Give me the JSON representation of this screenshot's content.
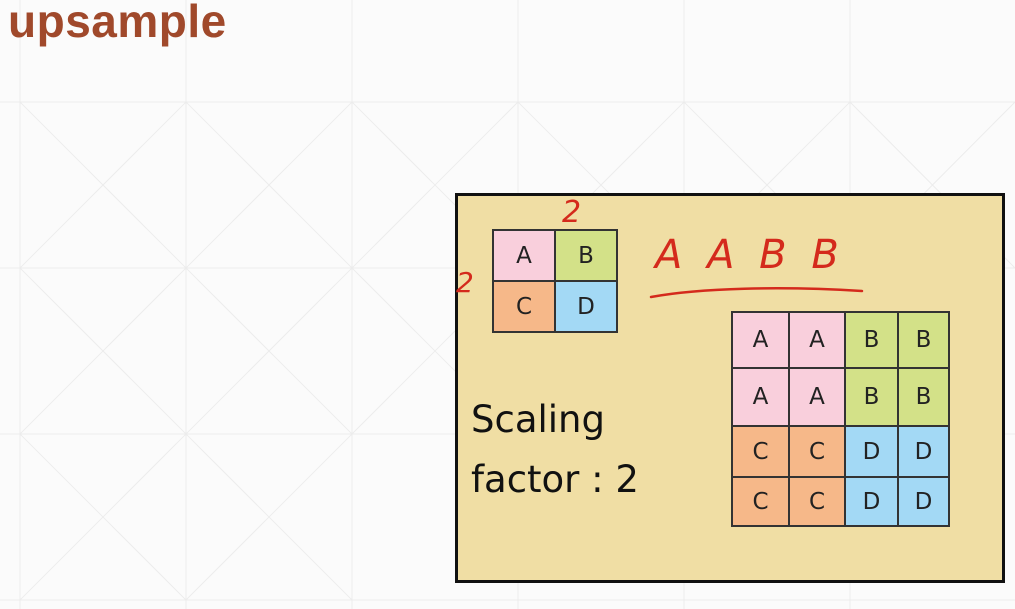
{
  "slide": {
    "title": "upsample"
  },
  "diagram": {
    "input_grid": {
      "rows": [
        [
          "A",
          "B"
        ],
        [
          "C",
          "D"
        ]
      ]
    },
    "output_grid": {
      "rows": [
        [
          "A",
          "A",
          "B",
          "B"
        ],
        [
          "A",
          "A",
          "B",
          "B"
        ],
        [
          "C",
          "C",
          "D",
          "D"
        ],
        [
          "C",
          "C",
          "D",
          "D"
        ]
      ]
    },
    "cell_colors": {
      "A": "#f9cfdc",
      "B": "#d3e188",
      "C": "#f6b889",
      "D": "#a3d9f5"
    },
    "scaling_label": [
      "Scaling",
      "factor : 2"
    ],
    "handwritten": {
      "top_mark": "2",
      "side_mark": "2",
      "sequence": "A A B B",
      "color": "#d42a1c"
    }
  }
}
